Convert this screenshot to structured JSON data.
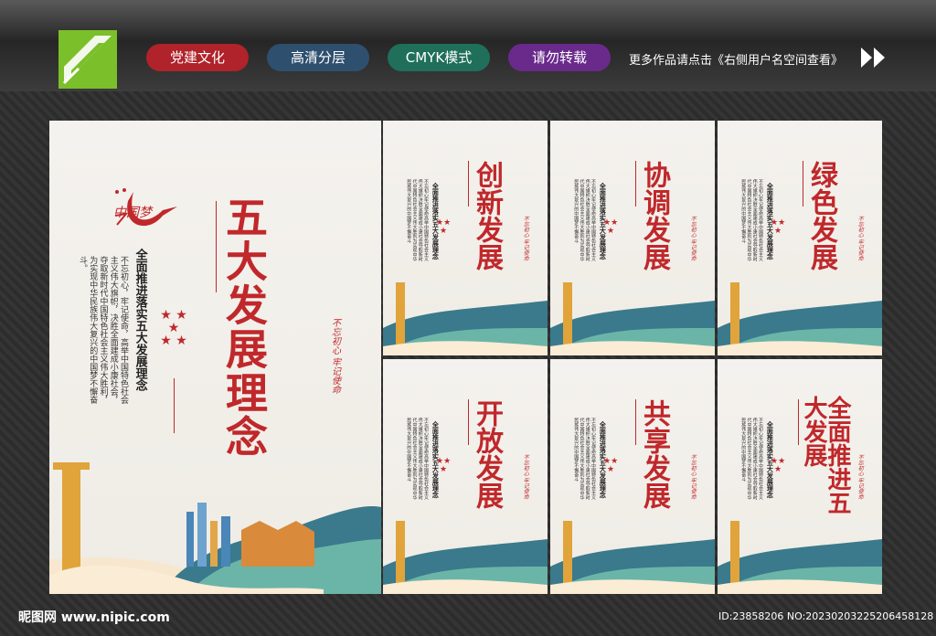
{
  "tags": [
    {
      "label": "党建文化",
      "color": "#b0232a"
    },
    {
      "label": "高清分层",
      "color": "#2f4f6e"
    },
    {
      "label": "CMYK模式",
      "color": "#1f6f5a"
    },
    {
      "label": "请勿转载",
      "color": "#6a2a8c"
    }
  ],
  "more_text": "更多作品请点击《右侧用户名空间查看》",
  "main_panel": {
    "title": "五大发展理念",
    "logo_text": "中国梦",
    "subtitle": "全面推进落实五大发展理念",
    "body": "不忘初心，牢记使命，高举中国特色社会主义伟大旗帜，决胜全面建成小康社会，夺取新时代中国特色社会主义伟大胜利，为实现中华民族伟大复兴的中国梦不懈奋斗。",
    "seal": "不忘初心 牢记使命",
    "stars": "★ ★\n★\n★ ★"
  },
  "small_panels": [
    {
      "title": "创新发展"
    },
    {
      "title": "协调发展"
    },
    {
      "title": "绿色发展"
    },
    {
      "title": "开放发展"
    },
    {
      "title": "共享发展"
    },
    {
      "title": "全面推进五大发展"
    }
  ],
  "small_common": {
    "subtitle": "全面推进落实五大发展理念",
    "body": "不忘初心牢记使命高举中国特色社会主义伟大旗帜决胜全面建成小康社会夺取新时代中国特色社会主义伟大胜利为实现中华民族伟大复兴的中国梦不懈奋斗",
    "seal": "不忘初心 牢记使命"
  },
  "footer": {
    "site": "昵图网 www.nipic.com",
    "id": "ID:23858206 NO:20230203225206458128"
  }
}
